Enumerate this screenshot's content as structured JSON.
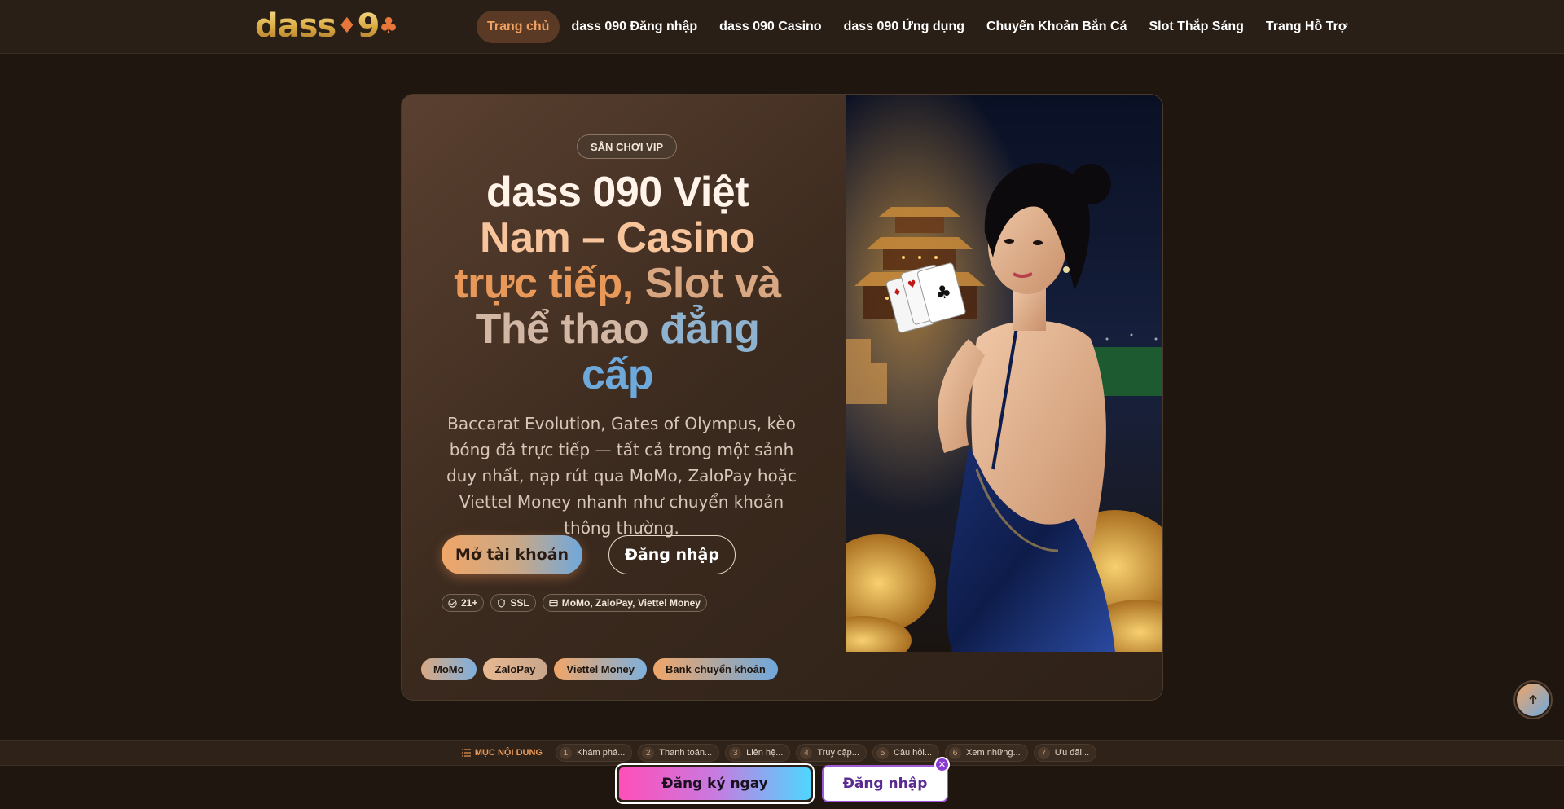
{
  "header": {
    "logo_text": "dass",
    "logo_suffix": "9",
    "nav": [
      {
        "label": "Trang chủ",
        "active": true
      },
      {
        "label": "dass 090 Đăng nhập"
      },
      {
        "label": "dass 090 Casino"
      },
      {
        "label": "dass 090 Ứng dụng"
      },
      {
        "label": "Chuyển Khoản Bắn Cá"
      },
      {
        "label": "Slot Thắp Sáng"
      },
      {
        "label": "Trang Hỗ Trợ"
      }
    ]
  },
  "hero": {
    "badge": "SÂN CHƠI VIP",
    "title_parts": [
      "dass 090 Việt",
      "Nam – Casino",
      "trực tiếp,",
      "Slot",
      "và",
      "Thể thao",
      "đẳng",
      "cấp"
    ],
    "description": "Baccarat Evolution, Gates of Olympus, kèo bóng đá trực tiếp — tất cả trong một sảnh duy nhất, nạp rút qua MoMo, ZaloPay hoặc Viettel Money nhanh như chuyển khoản thông thường.",
    "primary_button": "Mở tài khoản",
    "secondary_button": "Đăng nhập",
    "chips": [
      "21+",
      "SSL",
      "MoMo, ZaloPay, Viettel Money"
    ],
    "payments": [
      "MoMo",
      "ZaloPay",
      "Viettel Money",
      "Bank chuyển khoản"
    ]
  },
  "toc": {
    "title": "MỤC NỘI DUNG",
    "items": [
      {
        "num": "1",
        "label": "Khám phá..."
      },
      {
        "num": "2",
        "label": "Thanh toán..."
      },
      {
        "num": "3",
        "label": "Liên hệ..."
      },
      {
        "num": "4",
        "label": "Truy cập..."
      },
      {
        "num": "5",
        "label": "Câu hỏi..."
      },
      {
        "num": "6",
        "label": "Xem những..."
      },
      {
        "num": "7",
        "label": "Ưu đãi..."
      }
    ]
  },
  "cta": {
    "register": "Đăng ký ngay",
    "login": "Đăng nhập",
    "close": "✕"
  },
  "colors": {
    "background": "#1f1610",
    "accent_orange": "#e89858",
    "accent_blue": "#6fa8dc"
  }
}
